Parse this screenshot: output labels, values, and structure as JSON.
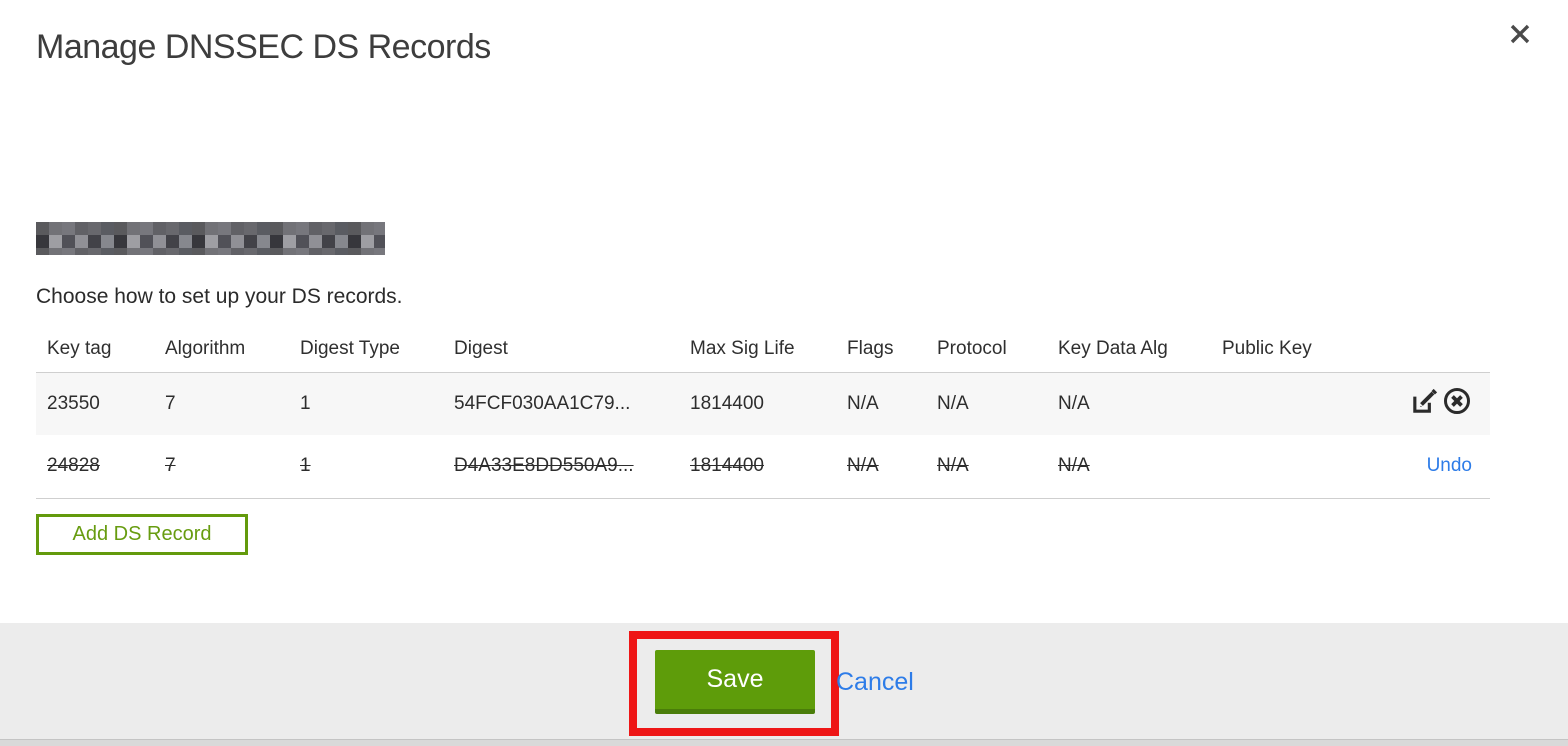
{
  "dialog": {
    "title": "Manage DNSSEC DS Records",
    "subtitle": "Choose how to set up your DS records.",
    "domain_redacted": true
  },
  "table": {
    "columns": [
      "Key tag",
      "Algorithm",
      "Digest Type",
      "Digest",
      "Max Sig Life",
      "Flags",
      "Protocol",
      "Key Data Alg",
      "Public Key"
    ],
    "rows": [
      {
        "cells": [
          "23550",
          "7",
          "1",
          "54FCF030AA1C79...",
          "1814400",
          "N/A",
          "N/A",
          "N/A",
          ""
        ],
        "deleted": false,
        "actions": [
          "edit",
          "delete"
        ]
      },
      {
        "cells": [
          "24828",
          "7",
          "1",
          "D4A33E8DD550A9...",
          "1814400",
          "N/A",
          "N/A",
          "N/A",
          ""
        ],
        "deleted": true,
        "actions": [
          "undo"
        ],
        "undo_label": "Undo"
      }
    ]
  },
  "buttons": {
    "add_ds_record": "Add DS Record",
    "save": "Save",
    "cancel": "Cancel"
  },
  "colors": {
    "save_button_green": "#5e9c0a",
    "add_button_green": "#639a0c",
    "link_blue": "#2d7ce8",
    "annotation_red": "#ee1616",
    "footer_gray": "#ececec",
    "row_alt_gray": "#f7f7f7"
  }
}
